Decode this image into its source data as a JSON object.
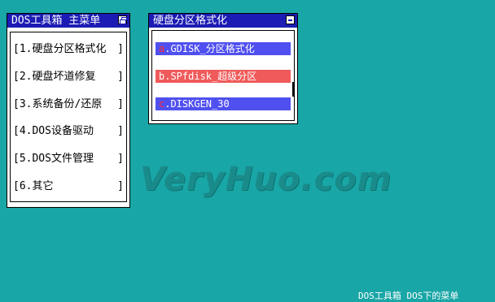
{
  "main_menu": {
    "title": "DOS工具箱 主菜单",
    "items": [
      {
        "label": "[1.硬盘分区格式化",
        "bracket": "]"
      },
      {
        "label": "[2.硬盘坏道修复",
        "bracket": "]"
      },
      {
        "label": "[3.系统备份/还原",
        "bracket": "]"
      },
      {
        "label": "[4.DOS设备驱动",
        "bracket": "]"
      },
      {
        "label": "[5.DOS文件管理",
        "bracket": "]"
      },
      {
        "label": "[6.其它",
        "bracket": "]"
      }
    ]
  },
  "submenu": {
    "title": "硬盘分区格式化",
    "options": [
      {
        "key": "a",
        "text": ".GDISK_分区格式化",
        "bg": "#5050f0"
      },
      {
        "key": "b",
        "text": ".SPfdisk_超级分区",
        "bg": "#f05a5a"
      },
      {
        "key": "c",
        "text": ".DISKGEN_30",
        "bg": "#5050f0"
      }
    ]
  },
  "watermark": "VeryHuo.com",
  "bottom_text": "DOS工具箱 DOS下的菜单",
  "colors": {
    "desktop": "#19A6A6",
    "titlebar": "#1c1cb4",
    "selected": "#f05a5a",
    "option": "#5050f0"
  }
}
